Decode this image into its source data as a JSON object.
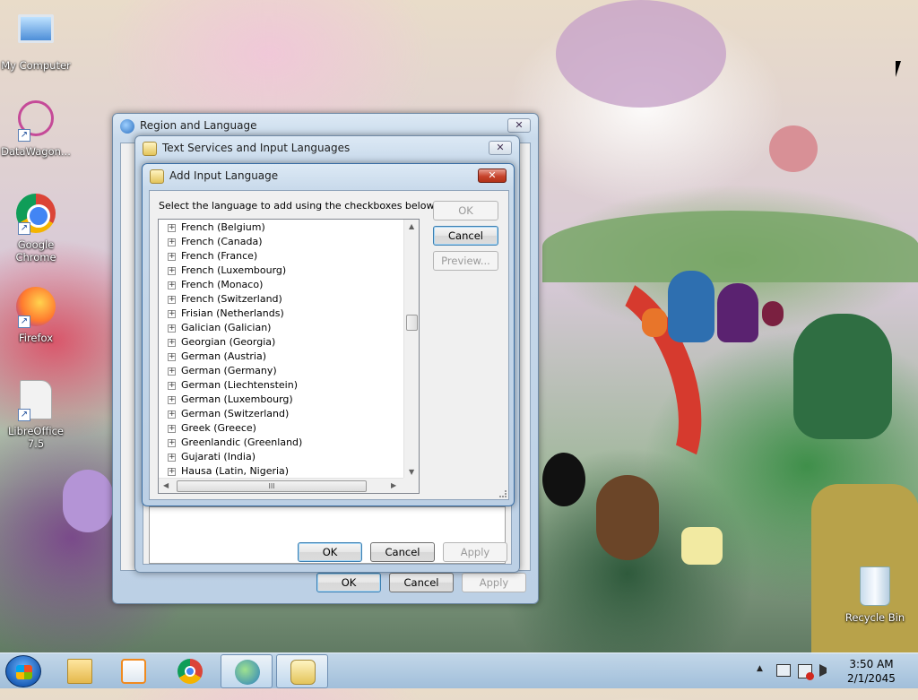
{
  "desktop": {
    "icons": [
      {
        "label": "My Computer"
      },
      {
        "label": "DataWagon..."
      },
      {
        "label": "Google Chrome"
      },
      {
        "label": "Firefox"
      },
      {
        "label": "LibreOffice 7.5"
      },
      {
        "label": "Recycle Bin"
      }
    ]
  },
  "region_window": {
    "title": "Region and Language",
    "close_glyph": "✕",
    "ok_label": "OK",
    "cancel_label": "Cancel",
    "apply_label": "Apply"
  },
  "text_services_window": {
    "title": "Text Services and Input Languages",
    "close_glyph": "✕",
    "ok_label": "OK",
    "cancel_label": "Cancel",
    "apply_label": "Apply"
  },
  "add_language_dialog": {
    "title": "Add Input Language",
    "close_glyph": "✕",
    "instruction": "Select the language to add using the checkboxes below.",
    "ok_label": "OK",
    "cancel_label": "Cancel",
    "preview_label": "Preview...",
    "expander_glyph": "+",
    "languages": [
      "French (Belgium)",
      "French (Canada)",
      "French (France)",
      "French (Luxembourg)",
      "French (Monaco)",
      "French (Switzerland)",
      "Frisian (Netherlands)",
      "Galician (Galician)",
      "Georgian (Georgia)",
      "German (Austria)",
      "German (Germany)",
      "German (Liechtenstein)",
      "German (Luxembourg)",
      "German (Switzerland)",
      "Greek (Greece)",
      "Greenlandic (Greenland)",
      "Gujarati (India)",
      "Hausa (Latin, Nigeria)"
    ],
    "hscroll_grip": "III"
  },
  "taskbar": {
    "clock_time": "3:50 AM",
    "clock_date": "2/1/2045",
    "tray_up_glyph": "▲"
  },
  "colors": {
    "accent": "#3c7fb1",
    "close_red": "#c7432c"
  }
}
